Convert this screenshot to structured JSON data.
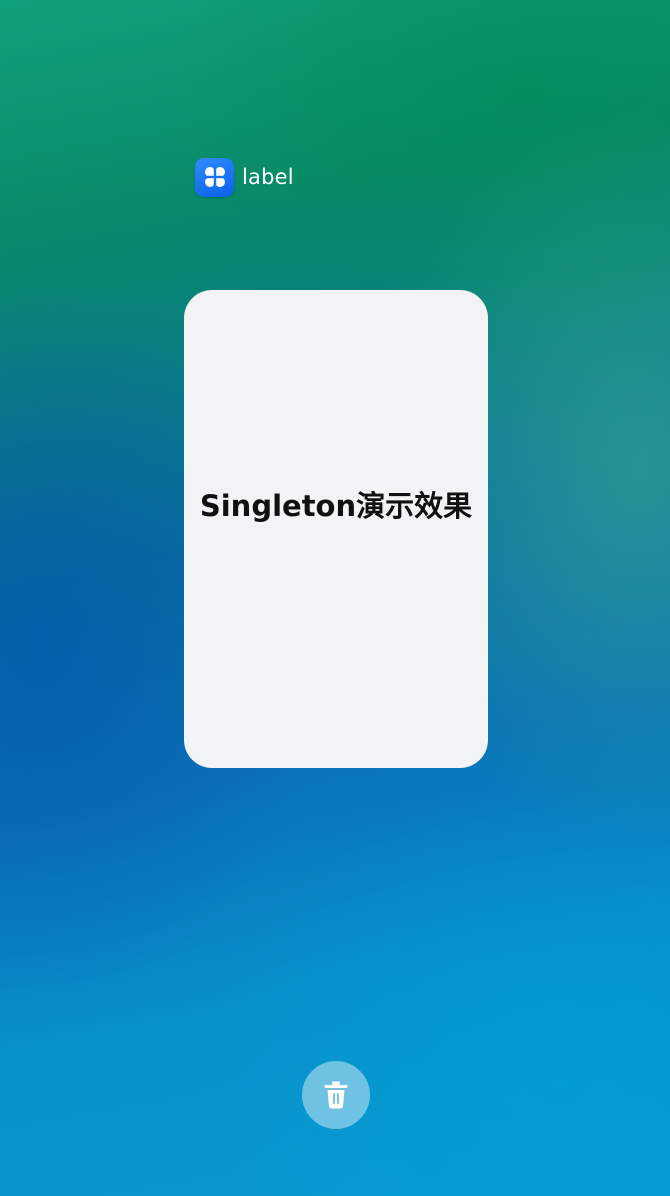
{
  "app": {
    "label": "label",
    "icon": "app-icon-four-petal"
  },
  "card": {
    "title": "Singleton演示效果"
  },
  "actions": {
    "clear_icon": "trash-icon"
  },
  "colors": {
    "card_background": "#f2f3f5",
    "app_icon_blue": "#1a74f0",
    "title_text": "#111111"
  }
}
